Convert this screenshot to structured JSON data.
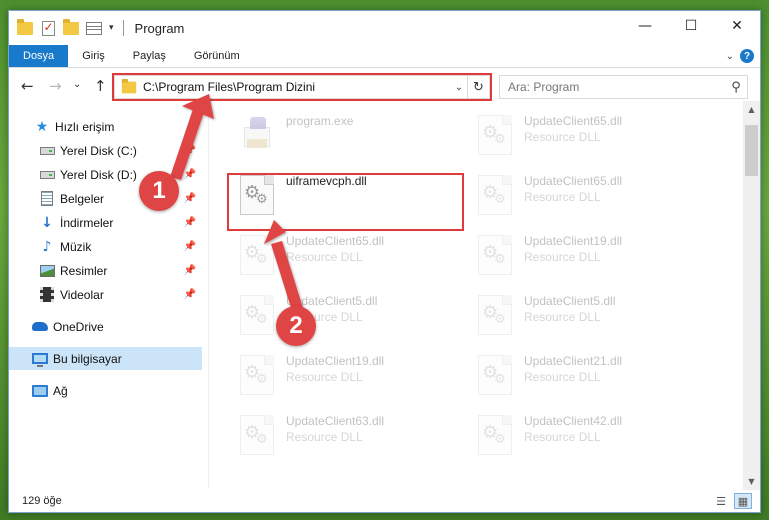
{
  "window": {
    "title": "Program"
  },
  "window_controls": {
    "minimize": "—",
    "maximize": "☐",
    "close": "✕"
  },
  "ribbon": {
    "tabs": [
      "Dosya",
      "Giriş",
      "Paylaş",
      "Görünüm"
    ],
    "help": "?"
  },
  "nav": {
    "back": "←",
    "forward": "→",
    "recent": "⌄",
    "up": "↑"
  },
  "address": {
    "path": "C:\\Program Files\\Program Dizini",
    "dropdown": "⌄",
    "refresh": "↻"
  },
  "search": {
    "placeholder": "Ara: Program",
    "icon": "⚲"
  },
  "sidebar": {
    "items": [
      {
        "label": "Hızlı erişim"
      },
      {
        "label": "Yerel Disk (C:)",
        "pinned": true
      },
      {
        "label": "Yerel Disk (D:)",
        "pinned": true
      },
      {
        "label": "Belgeler",
        "pinned": true
      },
      {
        "label": "İndirmeler",
        "pinned": true
      },
      {
        "label": "Müzik",
        "pinned": true
      },
      {
        "label": "Resimler",
        "pinned": true
      },
      {
        "label": "Videolar",
        "pinned": true
      },
      {
        "label": "OneDrive"
      },
      {
        "label": "Bu bilgisayar",
        "selected": true
      },
      {
        "label": "Ağ"
      }
    ],
    "pin_glyph": "📌"
  },
  "files": {
    "left": [
      {
        "name": "program.exe",
        "type": "",
        "faded": true
      },
      {
        "name": "uiframevcph.dll",
        "type": "",
        "faded": false
      },
      {
        "name": "UpdateClient65.dll",
        "type": "Resource DLL",
        "faded": true
      },
      {
        "name": "UpdateClient5.dll",
        "type": "Resource DLL",
        "faded": true
      },
      {
        "name": "UpdateClient19.dll",
        "type": "Resource DLL",
        "faded": true
      },
      {
        "name": "UpdateClient63.dll",
        "type": "Resource DLL",
        "faded": true
      }
    ],
    "right": [
      {
        "name": "UpdateClient65.dll",
        "type": "Resource DLL",
        "faded": true
      },
      {
        "name": "UpdateClient65.dll",
        "type": "Resource DLL",
        "faded": true
      },
      {
        "name": "UpdateClient19.dll",
        "type": "Resource DLL",
        "faded": true
      },
      {
        "name": "UpdateClient5.dll",
        "type": "Resource DLL",
        "faded": true
      },
      {
        "name": "UpdateClient21.dll",
        "type": "Resource DLL",
        "faded": true
      },
      {
        "name": "UpdateClient42.dll",
        "type": "Resource DLL",
        "faded": true
      }
    ]
  },
  "status": {
    "count": "129 öğe"
  },
  "annotations": {
    "step1": "1",
    "step2": "2",
    "color": "#e04545"
  },
  "scroll": {
    "up": "▲",
    "down": "▼"
  },
  "view_buttons": {
    "details": "☰",
    "tiles": "▦"
  }
}
